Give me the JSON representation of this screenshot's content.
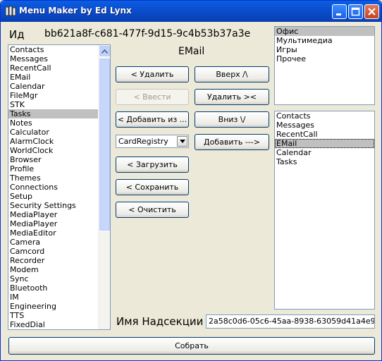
{
  "window": {
    "title": "Menu Maker by Ed Lynx"
  },
  "id_label": "Ид",
  "id_value": "bb621a8f-c681-477f-9d15-9c4b53b37a3e",
  "current_item": "EMail",
  "left_list": [
    "Contacts",
    "Messages",
    "RecentCall",
    "EMail",
    "Calendar",
    "FileMgr",
    "STK",
    "Tasks",
    "Notes",
    "Calculator",
    "AlarmClock",
    "WorldClock",
    "Browser",
    "Profile",
    "Themes",
    "Connections",
    "Setup",
    "Security Settings",
    "MediaPlayer",
    "MediaPlayer",
    "MediaEditor",
    "Camera",
    "Camcord",
    "Recorder",
    "Modem",
    "Sync",
    "Bluetooth",
    "IM",
    "Engineering",
    "TTS",
    "FixedDial"
  ],
  "left_list_selected": "Tasks",
  "buttons": {
    "delete_left": "< Удалить",
    "enter": "< Ввести",
    "add_from": "< Добавить из ...",
    "load": "< Загрузить",
    "save": "< Сохранить",
    "clear": "< Очистить",
    "up": "Вверх /\\",
    "delete_right": "Удалить ><",
    "down": "Вниз \\/",
    "add_right": "Добавить --->",
    "build": "Собрать"
  },
  "source_combo": {
    "value": "CardRegistry"
  },
  "sections": {
    "items": [
      "Офис",
      "Мультимедиа",
      "Игры",
      "Прочее"
    ],
    "selected": "Офис"
  },
  "section_items": {
    "items": [
      "Contacts",
      "Messages",
      "RecentCall",
      "EMail",
      "Calendar",
      "Tasks"
    ],
    "selected": "EMail"
  },
  "parent_section_label": "Имя Надсекции",
  "parent_section_value": "2a58c0d6-05c6-45aa-8938-63059d41a4e9",
  "colors": {
    "titlebar": "#0a4fd0",
    "face": "#ece9d8",
    "selection": "#c0c0c0"
  },
  "icons": [
    "app-icon",
    "minimize-icon",
    "maximize-icon",
    "close-icon",
    "scroll-up-arrow-icon",
    "scroll-down-arrow-icon",
    "dropdown-arrow-icon"
  ]
}
